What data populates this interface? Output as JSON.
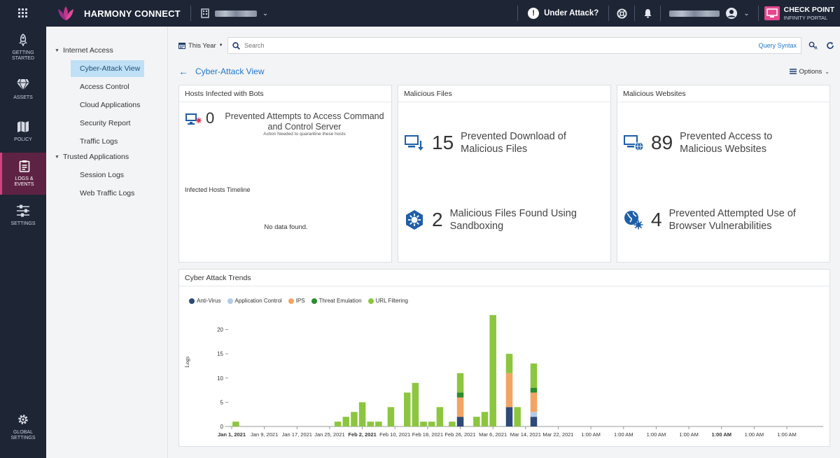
{
  "topbar": {
    "app_name": "HARMONY CONNECT",
    "under_attack": "Under Attack?",
    "brand_line1": "CHECK POINT",
    "brand_line2": "INFINITY PORTAL"
  },
  "leftnav": {
    "items": [
      {
        "label1": "GETTING",
        "label2": "STARTED"
      },
      {
        "label1": "ASSETS",
        "label2": ""
      },
      {
        "label1": "POLICY",
        "label2": ""
      },
      {
        "label1": "LOGS &",
        "label2": "EVENTS"
      },
      {
        "label1": "SETTINGS",
        "label2": ""
      }
    ],
    "bottom": {
      "label1": "GLOBAL",
      "label2": "SETTINGS"
    }
  },
  "subnav": {
    "group1": "Internet Access",
    "group1_items": [
      "Cyber-Attack View",
      "Access Control",
      "Cloud Applications",
      "Security Report",
      "Traffic Logs"
    ],
    "group2": "Trusted Applications",
    "group2_items": [
      "Session Logs",
      "Web Traffic Logs"
    ]
  },
  "search": {
    "timeframe": "This Year",
    "placeholder": "Search",
    "query_syntax": "Query Syntax"
  },
  "page": {
    "title": "Cyber-Attack View",
    "options": "Options"
  },
  "cards": {
    "bots": {
      "title": "Hosts Infected with Bots",
      "count": "0",
      "label": "Prevented Attempts to Access Command and Control Server",
      "sub": "Action Needed to quarantine these hosts",
      "timeline_title": "Infected Hosts Timeline",
      "no_data": "No data found."
    },
    "files": {
      "title": "Malicious Files",
      "count1": "15",
      "label1a": "Prevented Download of",
      "label1b": "Malicious Files",
      "count2": "2",
      "label2a": "Malicious Files Found Using",
      "label2b": "Sandboxing"
    },
    "websites": {
      "title": "Malicious Websites",
      "count1": "89",
      "label1a": "Prevented Access to",
      "label1b": "Malicious Websites",
      "count2": "4",
      "label2a": "Prevented Attempted Use of",
      "label2b": "Browser Vulnerabilities"
    },
    "trends": {
      "title": "Cyber Attack Trends"
    }
  },
  "chart_data": {
    "type": "bar",
    "stacked": true,
    "ylabel": "Logs",
    "ylim": [
      0,
      25
    ],
    "yticks": [
      0,
      5,
      10,
      15,
      20
    ],
    "xticks": [
      {
        "label": "Jan 1, 2021",
        "bold": true
      },
      {
        "label": "Jan 9, 2021",
        "bold": false
      },
      {
        "label": "Jan 17, 2021",
        "bold": false
      },
      {
        "label": "Jan 25, 2021",
        "bold": false
      },
      {
        "label": "Feb 2, 2021",
        "bold": true
      },
      {
        "label": "Feb 10, 2021",
        "bold": false
      },
      {
        "label": "Feb 18, 2021",
        "bold": false
      },
      {
        "label": "Feb 26, 2021",
        "bold": false
      },
      {
        "label": "Mar 6, 2021",
        "bold": false
      },
      {
        "label": "Mar 14, 2021",
        "bold": false
      },
      {
        "label": "Mar 22, 2021",
        "bold": false
      },
      {
        "label": "1:00 AM",
        "bold": false
      },
      {
        "label": "1:00 AM",
        "bold": false
      },
      {
        "label": "1:00 AM",
        "bold": false
      },
      {
        "label": "1:00 AM",
        "bold": false
      },
      {
        "label": "1:00 AM",
        "bold": true
      },
      {
        "label": "1:00 AM",
        "bold": false
      },
      {
        "label": "1:00 AM",
        "bold": false
      }
    ],
    "series_meta": [
      {
        "name": "Anti-Virus",
        "color": "#2d4a78"
      },
      {
        "name": "Application Control",
        "color": "#b4cbe6"
      },
      {
        "name": "IPS",
        "color": "#f3a464"
      },
      {
        "name": "Threat Emulation",
        "color": "#2b8c2b"
      },
      {
        "name": "URL Filtering",
        "color": "#8cc63f"
      }
    ],
    "bars": [
      {
        "day": 2,
        "values": [
          0,
          0,
          0,
          0,
          1
        ]
      },
      {
        "day": 27,
        "values": [
          0,
          0,
          0,
          0,
          1
        ]
      },
      {
        "day": 29,
        "values": [
          0,
          0,
          0,
          0,
          2
        ]
      },
      {
        "day": 31,
        "values": [
          0,
          0,
          0,
          0,
          3
        ]
      },
      {
        "day": 33,
        "values": [
          0,
          0,
          0,
          0,
          5
        ]
      },
      {
        "day": 35,
        "values": [
          0,
          0,
          0,
          0,
          1
        ]
      },
      {
        "day": 37,
        "values": [
          0,
          0,
          0,
          0,
          1
        ]
      },
      {
        "day": 40,
        "values": [
          0,
          0,
          0,
          0,
          4
        ]
      },
      {
        "day": 44,
        "values": [
          0,
          0,
          0,
          0,
          7
        ]
      },
      {
        "day": 46,
        "values": [
          0,
          0,
          0,
          0,
          9
        ]
      },
      {
        "day": 48,
        "values": [
          0,
          0,
          0,
          0,
          1
        ]
      },
      {
        "day": 50,
        "values": [
          0,
          0,
          0,
          0,
          1
        ]
      },
      {
        "day": 52,
        "values": [
          0,
          0,
          0,
          0,
          4
        ]
      },
      {
        "day": 55,
        "values": [
          0,
          0,
          0,
          0,
          1
        ]
      },
      {
        "day": 57,
        "values": [
          2,
          0,
          4,
          1,
          4
        ]
      },
      {
        "day": 61,
        "values": [
          0,
          0,
          0,
          0,
          2
        ]
      },
      {
        "day": 63,
        "values": [
          0,
          0,
          0,
          0,
          3
        ]
      },
      {
        "day": 65,
        "values": [
          0,
          0,
          0,
          0,
          23
        ]
      },
      {
        "day": 69,
        "values": [
          4,
          0,
          7,
          0,
          4
        ]
      },
      {
        "day": 71,
        "values": [
          0,
          0,
          0,
          0,
          4
        ]
      },
      {
        "day": 75,
        "values": [
          2,
          1,
          4,
          1,
          5
        ]
      }
    ]
  }
}
